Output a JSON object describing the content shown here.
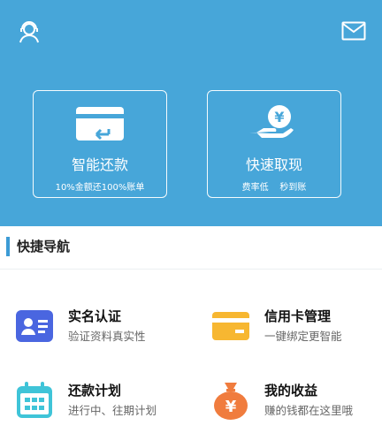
{
  "header": {
    "left_icon": "customer-service-icon",
    "right_icon": "mail-icon"
  },
  "cards": [
    {
      "icon": "card-repay-icon",
      "title": "智能还款",
      "subtitle": "10%金额还100%账单"
    },
    {
      "icon": "hand-yen-icon",
      "title": "快速取现",
      "subtitle": "费率低    秒到账"
    }
  ],
  "section": {
    "title": "快捷导航",
    "accent_color": "#3c9bd5"
  },
  "nav_items": [
    {
      "icon": "id-card-icon",
      "title": "实名认证",
      "subtitle": "验证资料真实性"
    },
    {
      "icon": "credit-card-icon",
      "title": "信用卡管理",
      "subtitle": "一键绑定更智能"
    },
    {
      "icon": "calendar-icon",
      "title": "还款计划",
      "subtitle": "进行中、往期计划"
    },
    {
      "icon": "money-bag-icon",
      "title": "我的收益",
      "subtitle": "赚的钱都在这里哦"
    }
  ],
  "colors": {
    "hero_bg": "#47a6d9",
    "id_card": "#4a66e0",
    "credit_card": "#f7b731",
    "calendar": "#3fc4d8",
    "money_bag": "#f07c3e"
  }
}
